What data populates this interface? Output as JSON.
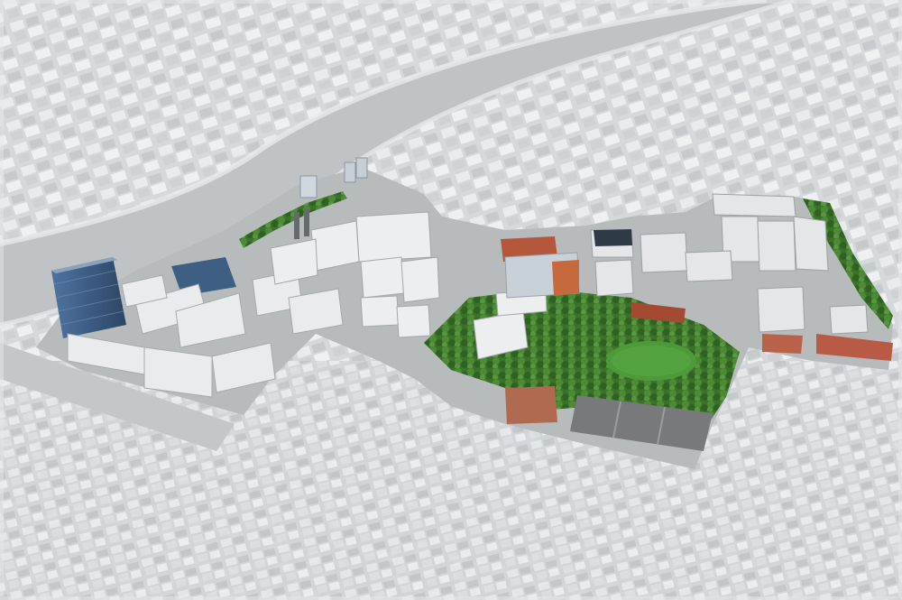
{
  "image": {
    "kind": "aerial-photograph",
    "subject": "campus",
    "colors": {
      "greyscale_ground": "#d7dadc",
      "river": "#bfc3c6",
      "river_bank": "#c9cdd0",
      "highlight_ground": "#b9bcbd",
      "tree_green": "#3f7a2e",
      "lawn_green": "#4e9a3a",
      "glass_tower_blue": "#3c5f86",
      "brick_red": "#b4573a",
      "roof_white": "#eceeef",
      "roof_grey": "#9a9ea3",
      "flat_roof_dark": "#77797b"
    }
  }
}
